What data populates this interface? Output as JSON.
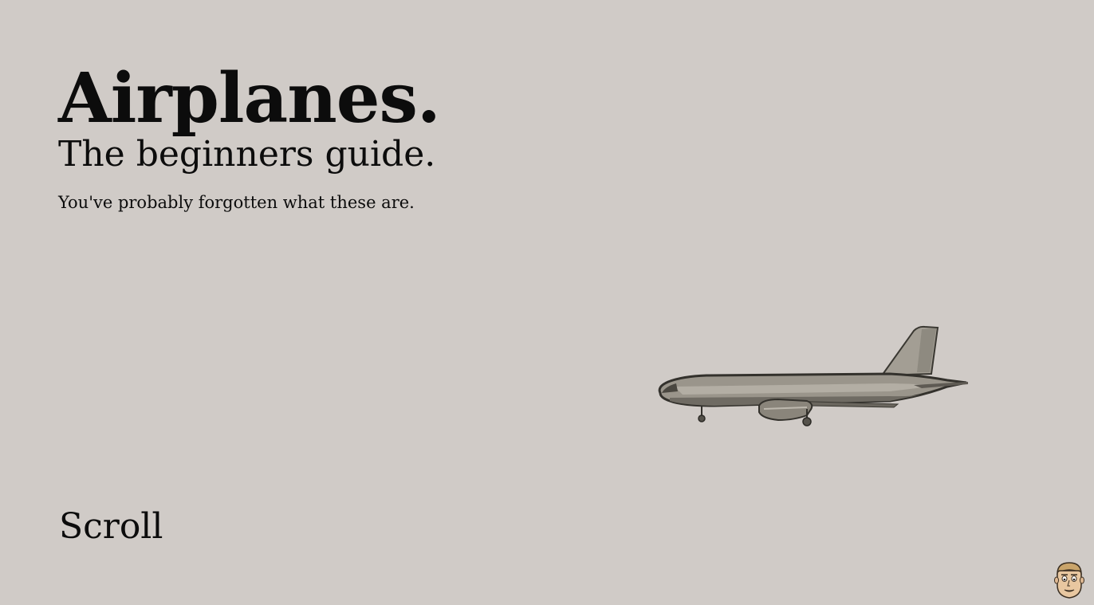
{
  "hero": {
    "title": "Airplanes.",
    "subtitle": "The beginners guide.",
    "tagline": "You've probably forgotten what these are."
  },
  "scroll_label": "Scroll",
  "icons": {
    "plane": "airplane-illustration",
    "avatar": "avatar-face-icon"
  },
  "colors": {
    "background": "#d0cbc7",
    "text": "#0c0c0c",
    "plane_body": "#8e8a80",
    "plane_outline": "#3a3832"
  }
}
